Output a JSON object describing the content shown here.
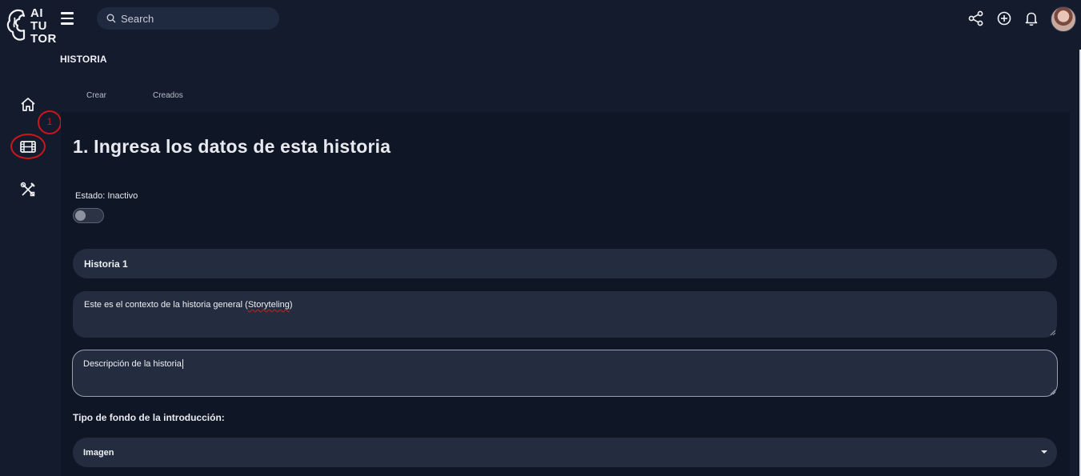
{
  "app": {
    "logo_text_lines": [
      "AI",
      "TU",
      "TOR"
    ],
    "search": {
      "placeholder": "Search"
    },
    "top_icons": [
      "share-icon",
      "add-circle-icon",
      "bell-icon"
    ],
    "user": {
      "avatar": "avatar"
    }
  },
  "page": {
    "title": "HISTORIA"
  },
  "sidebar": {
    "items": [
      {
        "icon": "home-icon"
      },
      {
        "icon": "film-icon",
        "selected": true
      },
      {
        "icon": "tools-icon"
      }
    ],
    "annotation_badge": "1"
  },
  "tabs": [
    {
      "label": "Crear"
    },
    {
      "label": "Creados"
    }
  ],
  "main": {
    "heading": "1. Ingresa los datos de esta historia",
    "status": {
      "label": "Estado: Inactivo",
      "active": false
    },
    "form": {
      "name": "Historia 1",
      "context_prefix": "Este es el contexto de la historia general (",
      "context_word": "Storyteling",
      "context_suffix": ")",
      "description": "Descripción de la historia",
      "background_label": "Tipo de fondo de la introducción:",
      "background_selected": "Imagen"
    }
  },
  "colors": {
    "background": "#141b2d",
    "panel": "#0f1626",
    "field": "#232d3f",
    "highlight": "#d0141c"
  }
}
